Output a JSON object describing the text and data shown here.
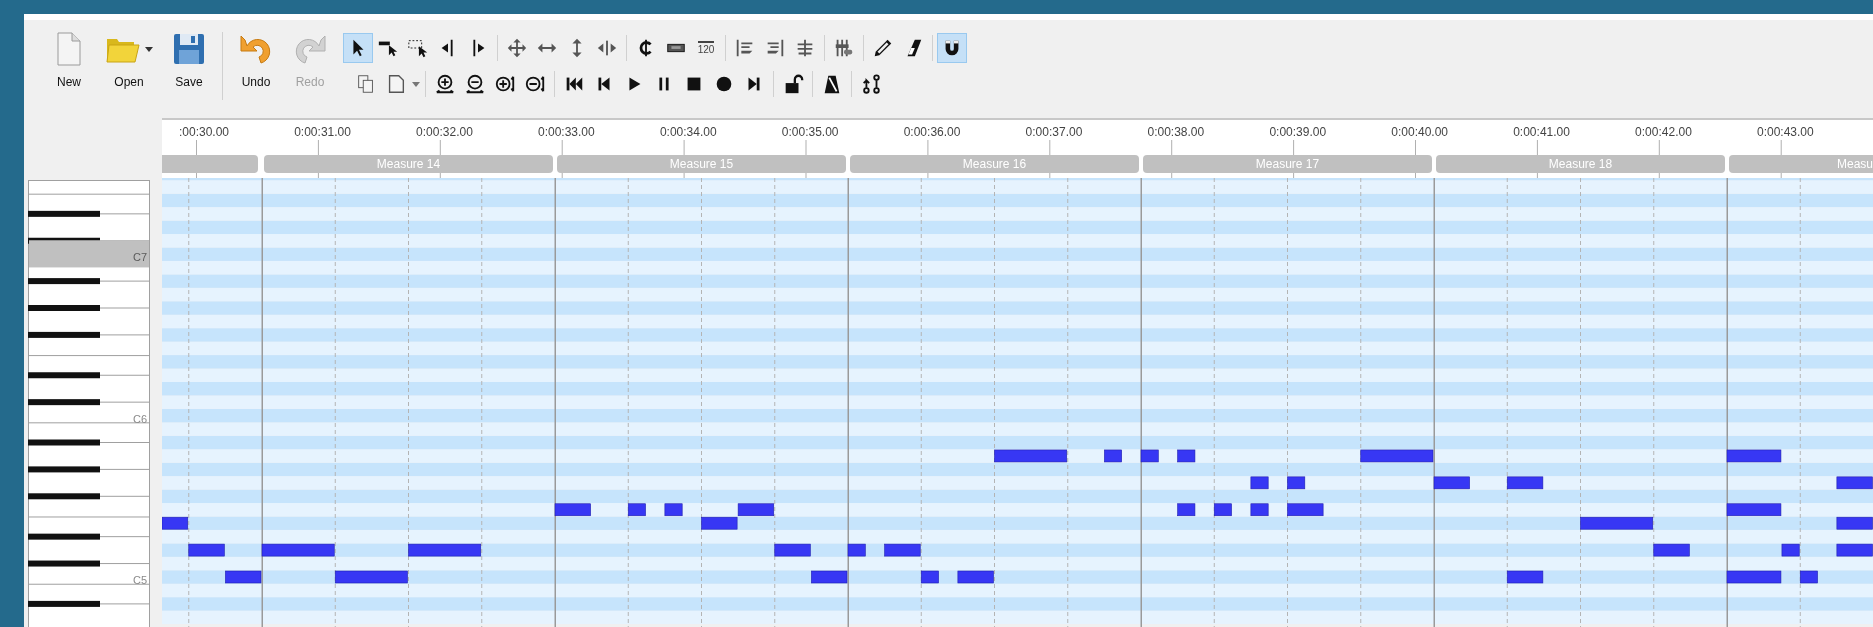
{
  "toolbar": {
    "buttons": [
      {
        "kind": "new",
        "label": "New",
        "disabled": false,
        "dropdown": false
      },
      {
        "kind": "open",
        "label": "Open",
        "disabled": false,
        "dropdown": true
      },
      {
        "kind": "save",
        "label": "Save",
        "disabled": false,
        "dropdown": false
      },
      {
        "kind": "separator"
      },
      {
        "kind": "undo",
        "label": "Undo",
        "disabled": false,
        "dropdown": false
      },
      {
        "kind": "redo",
        "label": "Redo",
        "disabled": true,
        "dropdown": false
      }
    ],
    "tools_row_1": [
      {
        "kind": "select",
        "selected": true
      },
      {
        "kind": "line-select",
        "selected": false
      },
      {
        "kind": "rect-select",
        "selected": false
      },
      {
        "kind": "left-select",
        "selected": false
      },
      {
        "kind": "right-select",
        "selected": false
      },
      {
        "kind": "separator"
      },
      {
        "kind": "move-all",
        "selected": false
      },
      {
        "kind": "move-h",
        "selected": false
      },
      {
        "kind": "move-v",
        "selected": false
      },
      {
        "kind": "scale-h",
        "selected": false
      },
      {
        "kind": "separator"
      },
      {
        "kind": "cent",
        "selected": false
      },
      {
        "kind": "block",
        "selected": false
      },
      {
        "kind": "tempo",
        "label": "120",
        "selected": false
      },
      {
        "kind": "separator"
      },
      {
        "kind": "align-left",
        "selected": false
      },
      {
        "kind": "align-right",
        "selected": false
      },
      {
        "kind": "align-center",
        "selected": false
      },
      {
        "kind": "separator"
      },
      {
        "kind": "mixer",
        "selected": false
      },
      {
        "kind": "separator"
      },
      {
        "kind": "pencil",
        "selected": false
      },
      {
        "kind": "eraser",
        "selected": false
      },
      {
        "kind": "separator"
      },
      {
        "kind": "magnet",
        "selected": true
      }
    ],
    "tools_row_2": [
      {
        "kind": "copy",
        "selected": false
      },
      {
        "kind": "paste",
        "selected": false
      },
      {
        "kind": "separator"
      },
      {
        "kind": "zoom-in-v",
        "selected": false
      },
      {
        "kind": "zoom-out-v",
        "selected": false
      },
      {
        "kind": "zoom-in-h",
        "selected": false
      },
      {
        "kind": "zoom-out-h",
        "selected": false
      },
      {
        "kind": "separator"
      },
      {
        "kind": "to-start",
        "selected": false
      },
      {
        "kind": "step-back",
        "selected": false
      },
      {
        "kind": "play",
        "selected": false
      },
      {
        "kind": "pause",
        "selected": false
      },
      {
        "kind": "stop",
        "selected": false
      },
      {
        "kind": "record",
        "selected": false
      },
      {
        "kind": "step-forward",
        "selected": false
      },
      {
        "kind": "separator"
      },
      {
        "kind": "lock",
        "selected": false
      },
      {
        "kind": "separator"
      },
      {
        "kind": "metronome",
        "selected": false
      },
      {
        "kind": "separator"
      },
      {
        "kind": "branch",
        "selected": false
      }
    ]
  },
  "timeline": {
    "times": [
      ":00:30.00",
      "0:00:31.00",
      "0:00:32.00",
      "0:00:33.00",
      "0:00:34.00",
      "0:00:35.00",
      "0:00:36.00",
      "0:00:37.00",
      "0:00:38.00",
      "0:00:39.00",
      "0:00:40.00",
      "0:00:41.00",
      "0:00:42.00",
      "0:00:43.00"
    ],
    "measures": [
      "Measure 14",
      "Measure 15",
      "Measure 16",
      "Measure 17",
      "Measure 18",
      "Measu"
    ]
  },
  "keyboard": {
    "octaves": [
      {
        "label": "C7",
        "highlighted": true
      },
      {
        "label": "C6",
        "highlighted": false
      },
      {
        "label": "C5",
        "highlighted": false
      }
    ]
  }
}
